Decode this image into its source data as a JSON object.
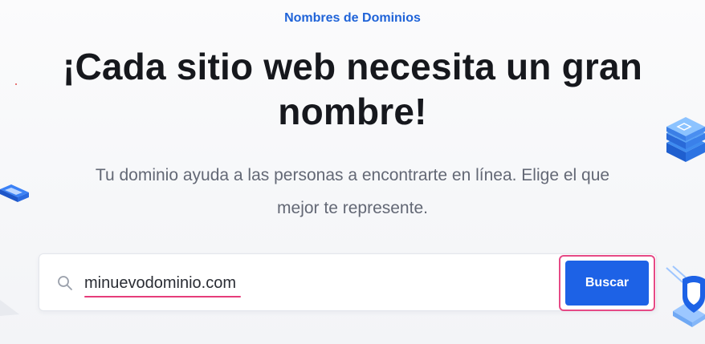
{
  "hero": {
    "eyebrow": "Nombres de Dominios",
    "title_line1": "¡Cada sitio web necesita un gran",
    "title_line2": "nombre!",
    "subtitle_line1": "Tu dominio ayuda a las personas a encontrarte en línea. Elige el que",
    "subtitle_line2": "mejor te represente."
  },
  "search": {
    "value": "minuevodominio.com",
    "button_label": "Buscar",
    "icon": "search-icon"
  },
  "colors": {
    "accent": "#1f63d8",
    "button": "#1d62e6",
    "highlight": "#e64a86",
    "heading": "#16181d",
    "subtitle": "#636875"
  }
}
